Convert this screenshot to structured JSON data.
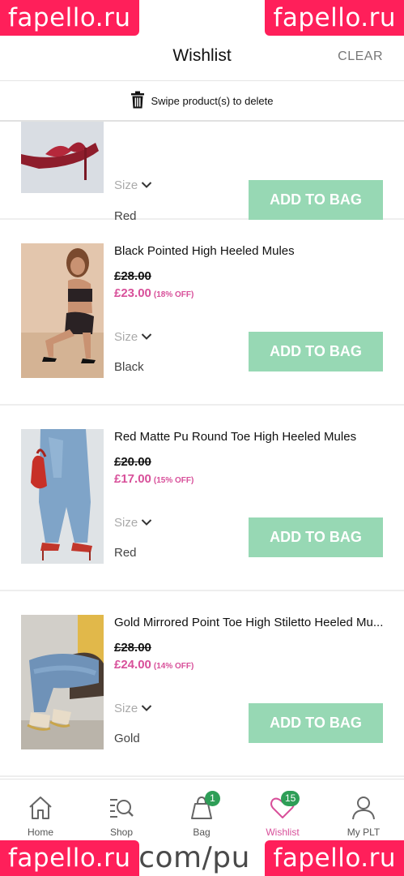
{
  "watermark": {
    "brand": "fapello.ru",
    "url": "s.com/pu"
  },
  "header": {
    "title": "Wishlist",
    "clear_label": "CLEAR"
  },
  "notice": {
    "text": "Swipe product(s) to delete",
    "icon": "trash-icon"
  },
  "items": [
    {
      "name": "",
      "was": "",
      "now": "",
      "off": "",
      "size_label": "Size",
      "color": "Red",
      "button": "ADD TO BAG"
    },
    {
      "name": "Black Pointed High Heeled Mules",
      "was": "£28.00",
      "now": "£23.00",
      "off": "(18% OFF)",
      "size_label": "Size",
      "color": "Black",
      "button": "ADD TO BAG"
    },
    {
      "name": "Red Matte Pu Round Toe High Heeled Mules",
      "was": "£20.00",
      "now": "£17.00",
      "off": "(15% OFF)",
      "size_label": "Size",
      "color": "Red",
      "button": "ADD TO BAG"
    },
    {
      "name": "Gold Mirrored Point Toe High Stiletto Heeled Mu...",
      "was": "£28.00",
      "now": "£24.00",
      "off": "(14% OFF)",
      "size_label": "Size",
      "color": "Gold",
      "button": "ADD TO BAG"
    }
  ],
  "tabs": [
    {
      "label": "Home",
      "icon": "home-icon"
    },
    {
      "label": "Shop",
      "icon": "shop-search-icon"
    },
    {
      "label": "Bag",
      "icon": "bag-icon",
      "badge": "1"
    },
    {
      "label": "Wishlist",
      "icon": "heart-icon",
      "badge": "15"
    },
    {
      "label": "My PLT",
      "icon": "user-icon"
    }
  ],
  "colors": {
    "accent": "#d8509a",
    "button": "#97d8b4",
    "badge": "#2e9e57",
    "watermark": "#ff1f5a"
  }
}
